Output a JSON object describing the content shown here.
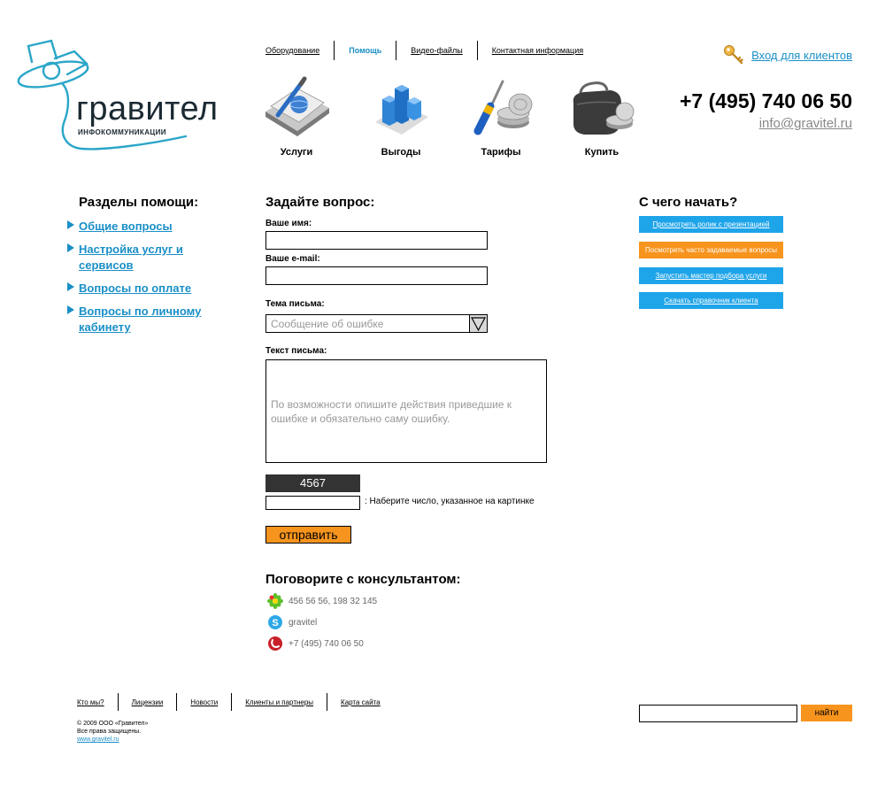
{
  "logo": {
    "name": "гравител",
    "subtitle": "ИНФОКОММУНИКАЦИИ"
  },
  "top_nav": {
    "items": [
      "Оборудование",
      "Помощь",
      "Видео-файлы",
      "Контактная информация"
    ],
    "active": "Помощь"
  },
  "login": {
    "label": "Вход для клиентов",
    "icon": "key-icon"
  },
  "contact_header": {
    "phone": "+7 (495) 740 06 50",
    "email": "info@gravitel.ru"
  },
  "icon_menu": [
    {
      "label": "Услуги",
      "icon": "book-globe-icon"
    },
    {
      "label": "Выгоды",
      "icon": "bar-chart-icon"
    },
    {
      "label": "Тарифы",
      "icon": "screwdriver-coins-icon"
    },
    {
      "label": "Купить",
      "icon": "wallet-coins-icon"
    }
  ],
  "help_sections": {
    "title": "Разделы помощи:",
    "items": [
      "Общие вопросы",
      "Настройка услуг и сервисов",
      "Вопросы по оплате",
      "Вопросы по личному кабинету"
    ]
  },
  "form": {
    "title": "Задайте вопрос:",
    "name_label": "Ваше имя:",
    "name_value": "",
    "email_label": "Ваше e-mail:",
    "email_value": "",
    "subject_label": "Тема письма:",
    "subject_value": "Сообщение об ошибке",
    "text_label": "Текст письма:",
    "text_placeholder": "По возможности опишите действия приведшие к ошибке и обязательно саму ошибку.",
    "captcha_code": "4567",
    "captcha_hint": ": Наберите число, указанное на картинке",
    "submit_label": "отправить"
  },
  "consultant": {
    "title": "Поговорите с консультантом:",
    "contacts": [
      {
        "icon": "icq-icon",
        "text": "456 56 56, 198 32 145"
      },
      {
        "icon": "skype-icon",
        "text": "gravitel"
      },
      {
        "icon": "phone-icon",
        "text": "+7 (495) 740 06 50"
      }
    ]
  },
  "start": {
    "title": "С чего начать?",
    "buttons": [
      {
        "label": "Просмотреть ролик с презентацией",
        "color": "#1ea4e9"
      },
      {
        "label": "Посмотреть часто задаваемые вопросы",
        "color": "#f7941d"
      },
      {
        "label": "Запустить мастер подбора услуги",
        "color": "#1ea4e9"
      },
      {
        "label": "Скачать справочник клиента",
        "color": "#1ea4e9"
      }
    ]
  },
  "footer": {
    "nav": [
      "Кто мы?",
      "Лицензии",
      "Новости",
      "Клиенты и партнеры",
      "Карта сайта"
    ],
    "copyright": "© 2009 ООО «Гравител»",
    "rights": "Все права защищены.",
    "site": "www.gravitel.ru",
    "search_button": "найти"
  },
  "colors": {
    "accent_blue": "#1a8fc7",
    "button_blue": "#1ea4e9",
    "button_orange": "#f7941d"
  }
}
